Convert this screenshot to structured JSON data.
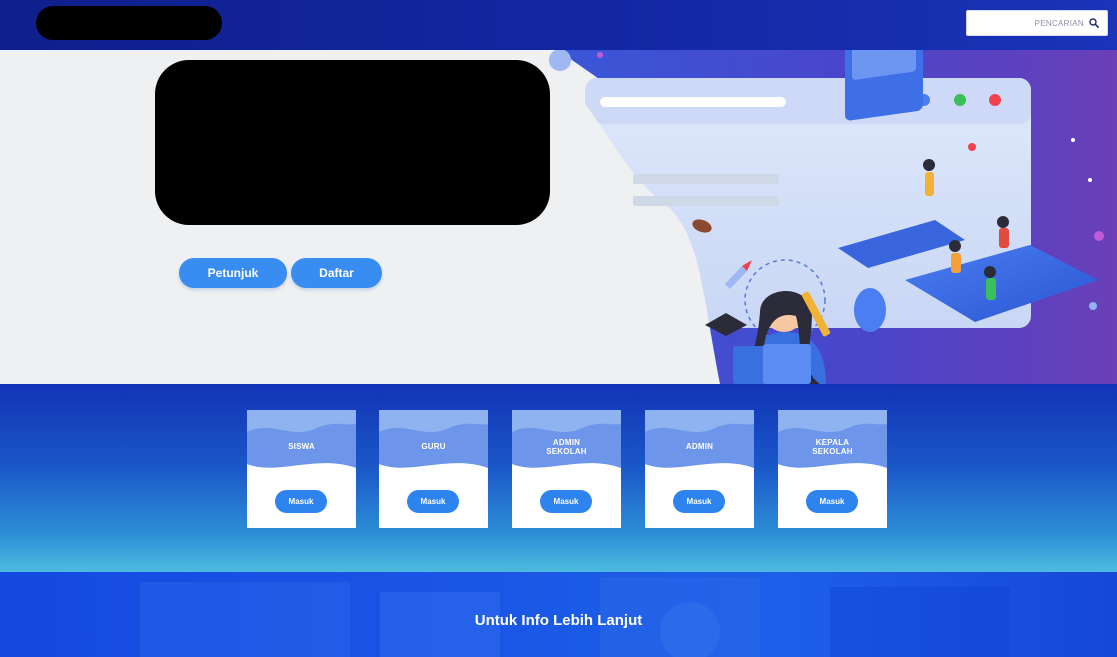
{
  "header": {
    "search": {
      "placeholder": "PENCARIAN"
    }
  },
  "hero": {
    "buttons": {
      "petunjuk": "Petunjuk",
      "daftar": "Daftar"
    }
  },
  "login_cards": [
    {
      "title": "SISWA",
      "button": "Masuk"
    },
    {
      "title": "GURU",
      "button": "Masuk"
    },
    {
      "title": "ADMIN SEKOLAH",
      "button": "Masuk"
    },
    {
      "title": "ADMIN",
      "button": "Masuk"
    },
    {
      "title": "KEPALA SEKOLAH",
      "button": "Masuk"
    }
  ],
  "info": {
    "title": "Untuk Info Lebih Lanjut"
  },
  "colors": {
    "nav_bg": "#1327a3",
    "accent_button": "#3a8df0",
    "band_top": "#1234b6",
    "band_bottom": "#4dbadf",
    "info_bg": "#1a55e6"
  },
  "icons": {
    "search": "search-icon",
    "browser_dots": [
      "blue-dot",
      "green-dot",
      "red-dot"
    ]
  }
}
